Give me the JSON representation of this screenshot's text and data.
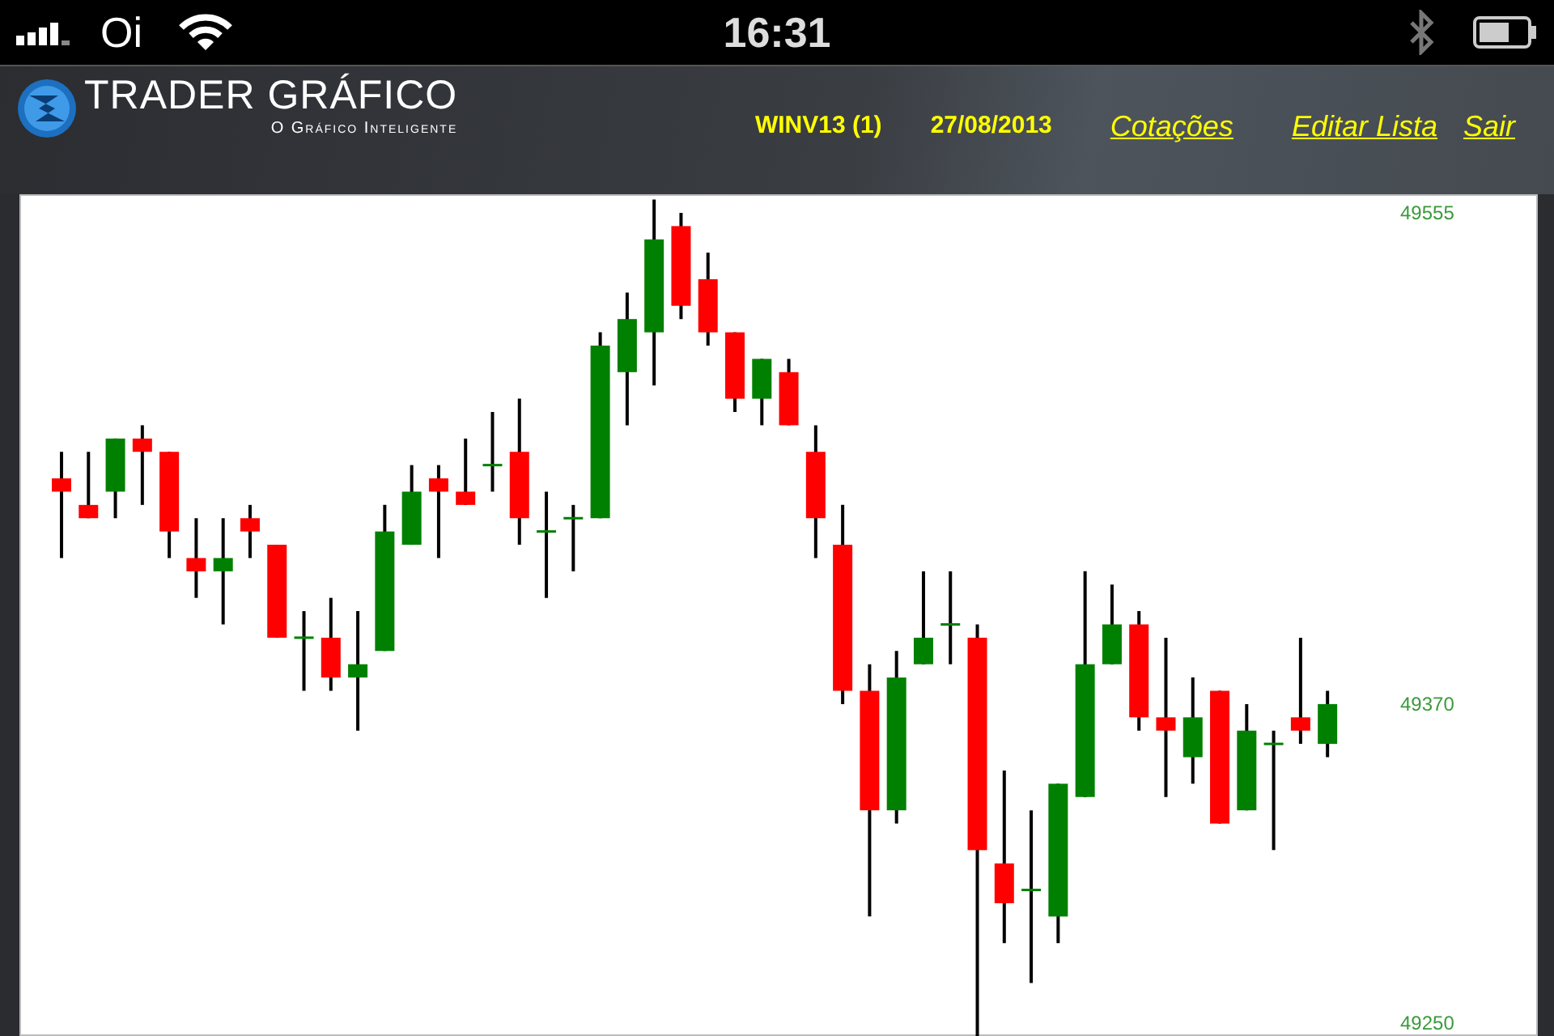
{
  "status_bar": {
    "carrier": "Oi",
    "time": "16:31"
  },
  "header": {
    "title": "TRADER GRÁFICO",
    "subtitle": "O Gráfico Inteligente",
    "symbol": "WINV13 (1)",
    "date": "27/08/2013",
    "links": [
      {
        "label": "Cotações"
      },
      {
        "label": "Editar Lista"
      },
      {
        "label": "Sair"
      }
    ]
  },
  "chart": {
    "chart_data": {
      "type": "candlestick",
      "ylim": [
        49245,
        49562
      ],
      "yticks": [
        49555,
        49370,
        49250
      ],
      "categories": [
        null,
        null,
        null,
        null,
        null,
        null,
        null,
        null,
        null,
        null,
        null,
        null,
        null,
        null,
        null,
        null,
        null,
        null,
        null,
        null,
        null,
        null,
        null,
        null,
        null,
        null,
        null,
        null,
        null,
        null,
        null,
        null,
        null,
        null,
        null,
        null,
        null,
        null,
        null,
        null,
        null,
        null,
        null,
        null,
        null,
        null,
        null,
        null
      ],
      "ohlc": [
        [
          49455,
          49465,
          49425,
          49450
        ],
        [
          49445,
          49465,
          49440,
          49440
        ],
        [
          49450,
          49470,
          49440,
          49470
        ],
        [
          49470,
          49475,
          49445,
          49465
        ],
        [
          49465,
          49465,
          49425,
          49435
        ],
        [
          49425,
          49440,
          49410,
          49420
        ],
        [
          49420,
          49440,
          49400,
          49425
        ],
        [
          49440,
          49445,
          49425,
          49435
        ],
        [
          49430,
          49430,
          49395,
          49395
        ],
        [
          49395,
          49405,
          49375,
          49395
        ],
        [
          49395,
          49410,
          49375,
          49380
        ],
        [
          49380,
          49405,
          49360,
          49385
        ],
        [
          49390,
          49445,
          49390,
          49435
        ],
        [
          49430,
          49460,
          49430,
          49450
        ],
        [
          49455,
          49460,
          49425,
          49450
        ],
        [
          49450,
          49470,
          49445,
          49445
        ],
        [
          49460,
          49480,
          49450,
          49460
        ],
        [
          49465,
          49485,
          49430,
          49440
        ],
        [
          49435,
          49450,
          49410,
          49435
        ],
        [
          49440,
          49445,
          49420,
          49440
        ],
        [
          49440,
          49510,
          49440,
          49505
        ],
        [
          49495,
          49525,
          49475,
          49515
        ],
        [
          49510,
          49560,
          49490,
          49545
        ],
        [
          49550,
          49555,
          49515,
          49520
        ],
        [
          49530,
          49540,
          49505,
          49510
        ],
        [
          49510,
          49510,
          49480,
          49485
        ],
        [
          49485,
          49500,
          49475,
          49500
        ],
        [
          49495,
          49500,
          49475,
          49475
        ],
        [
          49465,
          49475,
          49425,
          49440
        ],
        [
          49430,
          49445,
          49370,
          49375
        ],
        [
          49375,
          49385,
          49290,
          49330
        ],
        [
          49330,
          49390,
          49325,
          49380
        ],
        [
          49385,
          49420,
          49385,
          49395
        ],
        [
          49400,
          49420,
          49385,
          49400
        ],
        [
          49395,
          49400,
          49245,
          49315
        ],
        [
          49310,
          49345,
          49280,
          49295
        ],
        [
          49300,
          49330,
          49265,
          49300
        ],
        [
          49290,
          49340,
          49280,
          49340
        ],
        [
          49335,
          49420,
          49335,
          49385
        ],
        [
          49385,
          49415,
          49385,
          49400
        ],
        [
          49400,
          49405,
          49360,
          49365
        ],
        [
          49365,
          49395,
          49335,
          49360
        ],
        [
          49350,
          49380,
          49340,
          49365
        ],
        [
          49375,
          49375,
          49325,
          49325
        ],
        [
          49330,
          49370,
          49330,
          49360
        ],
        [
          49355,
          49360,
          49315,
          49355
        ],
        [
          49365,
          49395,
          49355,
          49360
        ],
        [
          49355,
          49375,
          49350,
          49370
        ]
      ]
    }
  }
}
